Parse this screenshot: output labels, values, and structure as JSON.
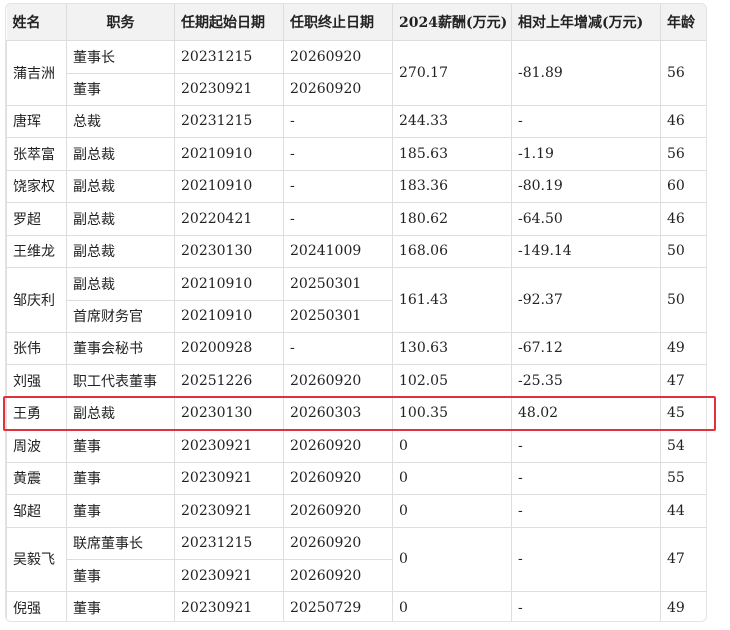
{
  "headers": [
    "姓名",
    "职务",
    "任期起始日期",
    "任职终止日期",
    "2024薪酬(万元)",
    "相对上年增减(万元)",
    "年龄"
  ],
  "people": [
    {
      "name": "蒲吉洲",
      "positions": [
        {
          "title": "董事长",
          "start": "20231215",
          "end": "20260920"
        },
        {
          "title": "董事",
          "start": "20230921",
          "end": "20260920"
        }
      ],
      "salary": "270.17",
      "change": "-81.89",
      "age": "56"
    },
    {
      "name": "唐珲",
      "positions": [
        {
          "title": "总裁",
          "start": "20231215",
          "end": "-"
        }
      ],
      "salary": "244.33",
      "change": "-",
      "age": "46"
    },
    {
      "name": "张萃富",
      "positions": [
        {
          "title": "副总裁",
          "start": "20210910",
          "end": "-"
        }
      ],
      "salary": "185.63",
      "change": "-1.19",
      "age": "56"
    },
    {
      "name": "饶家权",
      "positions": [
        {
          "title": "副总裁",
          "start": "20210910",
          "end": "-"
        }
      ],
      "salary": "183.36",
      "change": "-80.19",
      "age": "60"
    },
    {
      "name": "罗超",
      "positions": [
        {
          "title": "副总裁",
          "start": "20220421",
          "end": "-"
        }
      ],
      "salary": "180.62",
      "change": "-64.50",
      "age": "46"
    },
    {
      "name": "王维龙",
      "positions": [
        {
          "title": "副总裁",
          "start": "20230130",
          "end": "20241009"
        }
      ],
      "salary": "168.06",
      "change": "-149.14",
      "age": "50"
    },
    {
      "name": "邹庆利",
      "positions": [
        {
          "title": "副总裁",
          "start": "20210910",
          "end": "20250301"
        },
        {
          "title": "首席财务官",
          "start": "20210910",
          "end": "20250301"
        }
      ],
      "salary": "161.43",
      "change": "-92.37",
      "age": "50"
    },
    {
      "name": "张伟",
      "positions": [
        {
          "title": "董事会秘书",
          "start": "20200928",
          "end": "-"
        }
      ],
      "salary": "130.63",
      "change": "-67.12",
      "age": "49"
    },
    {
      "name": "刘强",
      "positions": [
        {
          "title": "职工代表董事",
          "start": "20251226",
          "end": "20260920"
        }
      ],
      "salary": "102.05",
      "change": "-25.35",
      "age": "47"
    },
    {
      "name": "王勇",
      "positions": [
        {
          "title": "副总裁",
          "start": "20230130",
          "end": "20260303"
        }
      ],
      "salary": "100.35",
      "change": "48.02",
      "age": "45",
      "highlighted": true
    },
    {
      "name": "周波",
      "positions": [
        {
          "title": "董事",
          "start": "20230921",
          "end": "20260920"
        }
      ],
      "salary": "0",
      "change": "-",
      "age": "54"
    },
    {
      "name": "黄震",
      "positions": [
        {
          "title": "董事",
          "start": "20230921",
          "end": "20260920"
        }
      ],
      "salary": "0",
      "change": "-",
      "age": "55"
    },
    {
      "name": "邹超",
      "positions": [
        {
          "title": "董事",
          "start": "20230921",
          "end": "20260920"
        }
      ],
      "salary": "0",
      "change": "-",
      "age": "44"
    },
    {
      "name": "吴毅飞",
      "positions": [
        {
          "title": "联席董事长",
          "start": "20231215",
          "end": "20260920"
        },
        {
          "title": "董事",
          "start": "20230921",
          "end": "20260920"
        }
      ],
      "salary": "0",
      "change": "-",
      "age": "47"
    },
    {
      "name": "倪强",
      "positions": [
        {
          "title": "董事",
          "start": "20230921",
          "end": "20250729"
        }
      ],
      "salary": "0",
      "change": "-",
      "age": "49"
    }
  ],
  "highlight_color": "#e0323c"
}
